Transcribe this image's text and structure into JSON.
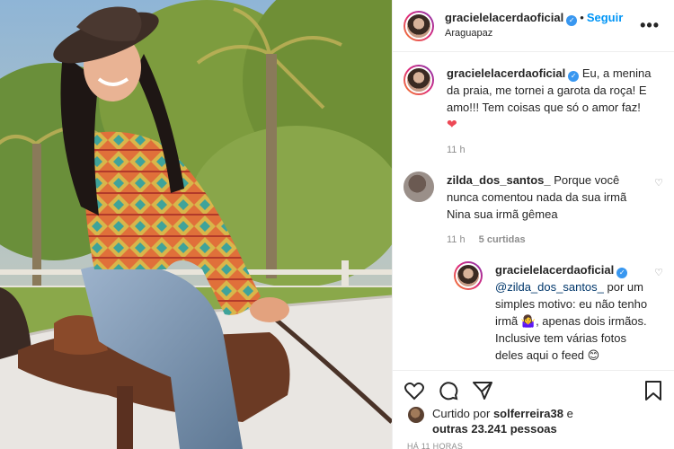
{
  "header": {
    "username": "gracielelacerdaoficial",
    "separator": "•",
    "follow_label": "Seguir",
    "location": "Araguapaz",
    "more_icon": "more-horizontal-icon"
  },
  "caption": {
    "username": "gracielelacerdaoficial",
    "text": "Eu, a menina da praia, me tornei a garota da roça! E amo!!! Tem coisas que só o amor faz!",
    "emoji": "❤",
    "time": "11 h"
  },
  "comments": [
    {
      "username": "zilda_dos_santos_",
      "text": "Porque você nunca comentou nada da sua irmã Nina sua irmã gêmea",
      "time": "11 h",
      "likes": "5 curtidas"
    }
  ],
  "reply": {
    "username": "gracielelacerdaoficial",
    "mention": "@zilda_dos_santos_",
    "text": "por um simples motivo: eu não tenho irmã 🤷‍♀️, apenas dois irmãos. Inclusive tem várias fotos deles aqui o feed 😊"
  },
  "likes": {
    "prefix": "Curtido por",
    "user": "solferreira38",
    "middle": "e",
    "others": "outras 23.241 pessoas"
  },
  "timestamp": "HÁ 11 HORAS",
  "colors": {
    "accent": "#0095f6",
    "verified": "#3897f0",
    "heart": "#ed4956"
  }
}
